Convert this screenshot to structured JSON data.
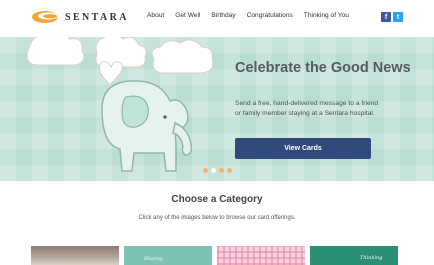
{
  "brand": {
    "name": "SENTARA"
  },
  "nav": {
    "items": [
      {
        "label": "About"
      },
      {
        "label": "Get Well"
      },
      {
        "label": "Birthday"
      },
      {
        "label": "Congratulations"
      },
      {
        "label": "Thinking of You"
      }
    ]
  },
  "social": {
    "facebook": "f",
    "twitter": "t"
  },
  "hero": {
    "title": "Celebrate the Good News",
    "text": "Send a free, hand-delivered message to a friend or family member staying at a Sentara hospital.",
    "button_label": "View Cards",
    "slide_count": 4,
    "active_slide": 2,
    "background_color": "#b9ddd3",
    "button_color": "#324a7a"
  },
  "category": {
    "title": "Choose a Category",
    "subtitle": "Click any of the images below to browse our card offerings."
  },
  "thumbnails": [
    {
      "caption": ""
    },
    {
      "caption": "Hooray"
    },
    {
      "caption": ""
    },
    {
      "caption": "Thinking"
    }
  ]
}
